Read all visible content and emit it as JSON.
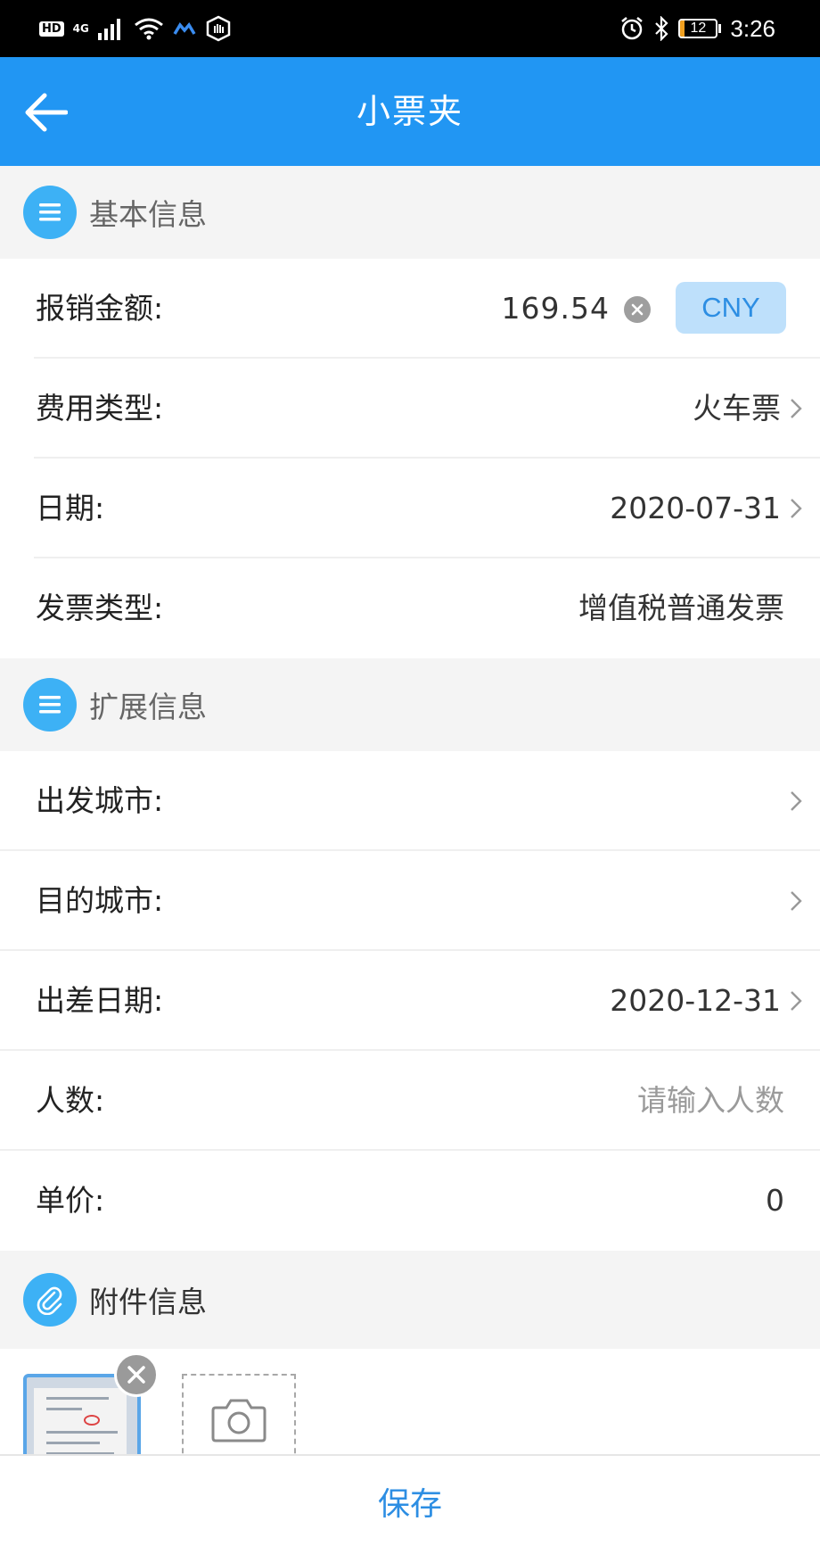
{
  "status_bar": {
    "hd": "HD",
    "network": "4G",
    "battery_level": "12",
    "battery_fraction": 0.12,
    "time": "3:26"
  },
  "app_bar": {
    "title": "小票夹"
  },
  "basic_section": {
    "title": "基本信息",
    "amount_label": "报销金额:",
    "amount_value": "169.54",
    "currency": "CNY",
    "expense_type_label": "费用类型:",
    "expense_type_value": "火车票",
    "date_label": "日期:",
    "date_value": "2020-07-31",
    "invoice_type_label": "发票类型:",
    "invoice_type_value": "增值税普通发票"
  },
  "extended_section": {
    "title": "扩展信息",
    "departure_city_label": "出发城市:",
    "departure_city_value": "",
    "destination_city_label": "目的城市:",
    "destination_city_value": "",
    "trip_date_label": "出差日期:",
    "trip_date_value": "2020-12-31",
    "people_label": "人数:",
    "people_placeholder": "请输入人数",
    "unit_price_label": "单价:",
    "unit_price_value": "0"
  },
  "attachment_section": {
    "title": "附件信息"
  },
  "footer": {
    "save_label": "保存"
  },
  "colors": {
    "primary": "#2196f3",
    "accent_text": "#2d8ee3",
    "section_icon": "#3db1f5",
    "battery": "#f0a020"
  }
}
